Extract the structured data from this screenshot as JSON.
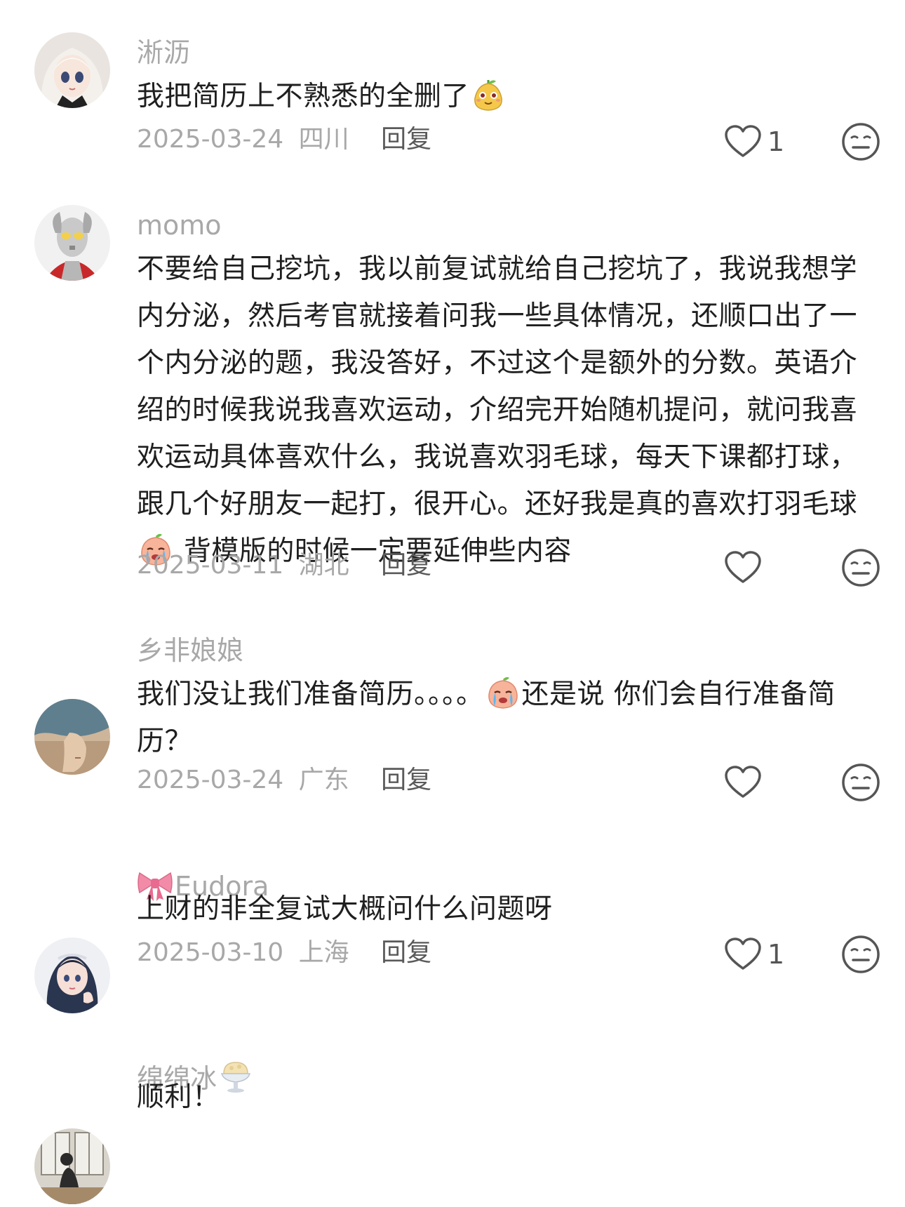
{
  "comments": [
    {
      "username": "淅沥",
      "username_prefix_emoji": "",
      "username_suffix_emoji": "",
      "avatar_icon": "doll-avatar",
      "text_parts": [
        "我把简历上不熟悉的全删了"
      ],
      "inline_emoji": [
        "cheeky-pear-emoji"
      ],
      "date": "2025-03-24",
      "region": "四川",
      "reply_label": "回复",
      "like_count": "1"
    },
    {
      "username": "momo",
      "username_prefix_emoji": "",
      "username_suffix_emoji": "",
      "avatar_icon": "ultraman-avatar",
      "text_parts": [
        "不要给自己挖坑，我以前复试就给自己挖坑了，我说我想学内分泌，然后考官就接着问我一些具体情况，还顺口出了一个内分泌的题，我没答好，不过这个是额外的分数。英语介绍的时候我说我喜欢运动，介绍完开始随机提问，就问我喜欢运动具体喜欢什么，我说喜欢羽毛球，每天下课都打球，跟几个好朋友一起打，很开心。还好我是真的喜欢打羽毛球",
        " 背模版的时候一定要延伸些内容"
      ],
      "inline_emoji": [
        "crying-peach-emoji"
      ],
      "date": "2025-03-11",
      "region": "湖北",
      "reply_label": "回复",
      "like_count": ""
    },
    {
      "username": "乡非娘娘",
      "username_prefix_emoji": "",
      "username_suffix_emoji": "",
      "avatar_icon": "profile-hat-avatar",
      "text_parts": [
        "我们没让我们准备简历。。。。",
        "还是说 你们会自行准备简历？"
      ],
      "inline_emoji": [
        "crying-peach-emoji"
      ],
      "date": "2025-03-24",
      "region": "广东",
      "reply_label": "回复",
      "like_count": ""
    },
    {
      "username": "Eudora",
      "username_prefix_emoji": "bow-emoji",
      "username_suffix_emoji": "",
      "avatar_icon": "anime-girl-avatar",
      "text_parts": [
        "上财的非全复试大概问什么问题呀"
      ],
      "inline_emoji": [],
      "date": "2025-03-10",
      "region": "上海",
      "reply_label": "回复",
      "like_count": "1"
    },
    {
      "username": "绵绵冰",
      "username_prefix_emoji": "",
      "username_suffix_emoji": "ice-cream-emoji",
      "avatar_icon": "window-girl-avatar",
      "text_parts": [
        "顺利！"
      ],
      "inline_emoji": [],
      "date": "",
      "region": "",
      "reply_label": "",
      "like_count": ""
    }
  ],
  "icons": {
    "like": "heart-outline-icon",
    "dislike": "meh-face-icon"
  },
  "colors": {
    "username": "#a8a8a8",
    "meta": "#a8a8a8",
    "text": "#1f1f1f",
    "icon": "#555555"
  }
}
